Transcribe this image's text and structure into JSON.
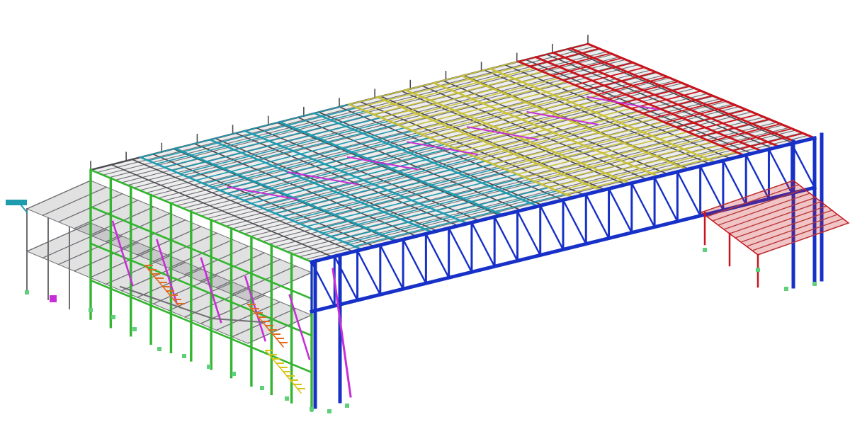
{
  "colors": {
    "background": "#ffffff",
    "roof_gray": "#6d6d72",
    "roof_dark": "#4a4a50",
    "bay_cyan": "#1f9bb0",
    "bay_yellow": "#c9c23a",
    "bay_red": "#c8141c",
    "frame_green": "#33b52f",
    "truss_blue": "#1730c8",
    "bracing_magenta": "#c72fd6",
    "stair_orange": "#e06a1e",
    "stair_yellow": "#d9c318",
    "base_marker": "#5fd07a",
    "mezzanine_red": "#b83a3a"
  },
  "diagram": {
    "subject": "",
    "regions": [
      "roof-structure",
      "cyan-bay",
      "yellow-bay",
      "red-bay",
      "green-end-frame",
      "blue-truss-girder",
      "left-mezzanine",
      "right-mezzanine",
      "stairs"
    ]
  }
}
